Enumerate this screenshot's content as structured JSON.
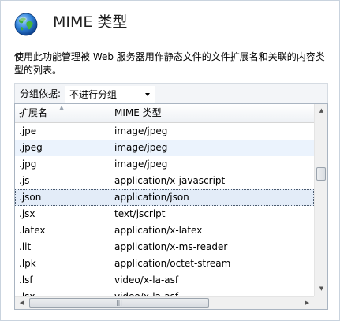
{
  "header": {
    "title": "MIME 类型",
    "icon": "globe-icon"
  },
  "description": "使用此功能管理被 Web 服务器用作静态文件的文件扩展名和关联的内容类型的列表。",
  "grouping": {
    "label": "分组依据:",
    "selected": "不进行分组"
  },
  "table": {
    "columns": [
      "扩展名",
      "MIME 类型"
    ],
    "sorted_column": "扩展名",
    "rows": [
      {
        "ext": ".jpe",
        "mime": "image/jpeg"
      },
      {
        "ext": ".jpeg",
        "mime": "image/jpeg"
      },
      {
        "ext": ".jpg",
        "mime": "image/jpeg"
      },
      {
        "ext": ".js",
        "mime": "application/x-javascript"
      },
      {
        "ext": ".json",
        "mime": "application/json"
      },
      {
        "ext": ".jsx",
        "mime": "text/jscript"
      },
      {
        "ext": ".latex",
        "mime": "application/x-latex"
      },
      {
        "ext": ".lit",
        "mime": "application/x-ms-reader"
      },
      {
        "ext": ".lpk",
        "mime": "application/octet-stream"
      },
      {
        "ext": ".lsf",
        "mime": "video/x-la-asf"
      },
      {
        "ext": ".lsx",
        "mime": "video/x-la-asf"
      }
    ],
    "selected_row": ".json"
  },
  "colors": {
    "accent_row": "#ebf3fd",
    "selected_row": "#e3ecf8",
    "border": "#a9b4c1"
  }
}
